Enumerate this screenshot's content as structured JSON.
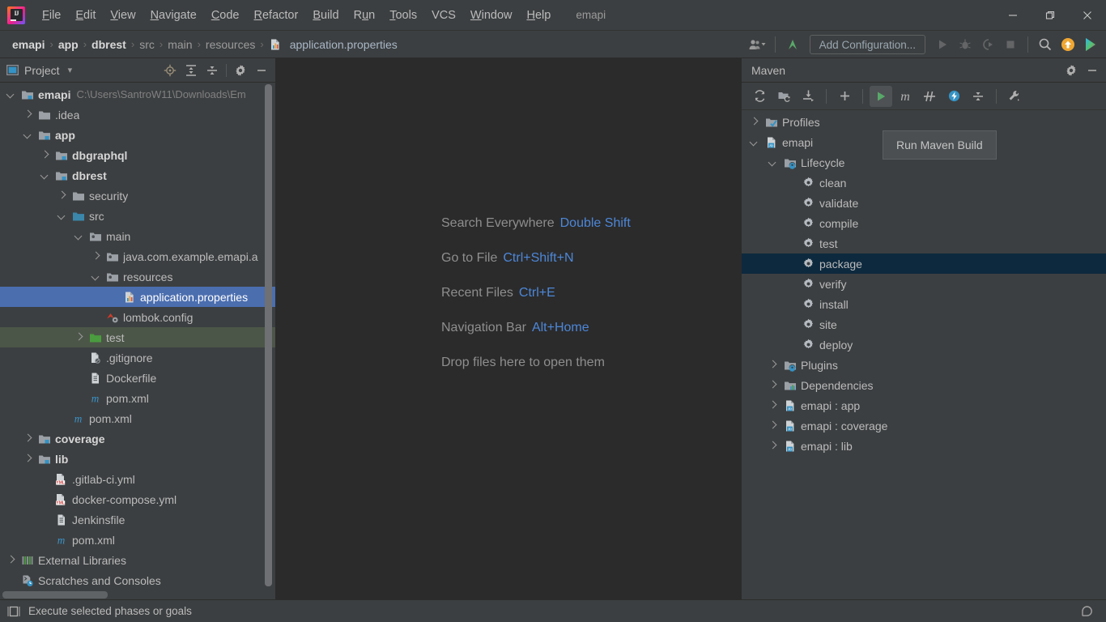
{
  "window": {
    "title": "emapi",
    "logo_text": "IJ",
    "controls": [
      {
        "name": "minimize",
        "glyph": "—"
      },
      {
        "name": "maximize",
        "glyph": "❐"
      },
      {
        "name": "close",
        "glyph": "✕"
      }
    ]
  },
  "menubar": {
    "items": [
      {
        "label": "File",
        "mnemonic": "F"
      },
      {
        "label": "Edit",
        "mnemonic": "E"
      },
      {
        "label": "View",
        "mnemonic": "V"
      },
      {
        "label": "Navigate",
        "mnemonic": "N"
      },
      {
        "label": "Code",
        "mnemonic": "C"
      },
      {
        "label": "Refactor",
        "mnemonic": "R"
      },
      {
        "label": "Build",
        "mnemonic": "B"
      },
      {
        "label": "Run",
        "mnemonic": "u"
      },
      {
        "label": "Tools",
        "mnemonic": "T"
      },
      {
        "label": "VCS",
        "mnemonic": ""
      },
      {
        "label": "Window",
        "mnemonic": "W"
      },
      {
        "label": "Help",
        "mnemonic": "H"
      }
    ]
  },
  "navbar": {
    "breadcrumbs": [
      {
        "label": "emapi",
        "style": "bold"
      },
      {
        "label": "app",
        "style": "bold"
      },
      {
        "label": "dbrest",
        "style": "bold"
      },
      {
        "label": "src",
        "style": "dim"
      },
      {
        "label": "main",
        "style": "dim"
      },
      {
        "label": "resources",
        "style": "dim"
      },
      {
        "label": "application.properties",
        "style": "file",
        "icon": "properties-file-icon"
      }
    ],
    "separator": "›",
    "run_configuration": "Add Configuration...",
    "buttons": [
      {
        "name": "user-settings-icon",
        "label": ""
      },
      {
        "name": "update-project-icon",
        "label": ""
      },
      {
        "name": "run-icon",
        "label": ""
      },
      {
        "name": "debug-icon",
        "label": ""
      },
      {
        "name": "run-with-coverage-icon",
        "label": ""
      },
      {
        "name": "stop-icon",
        "label": ""
      },
      {
        "name": "search-icon",
        "label": ""
      },
      {
        "name": "notification-icon",
        "label": ""
      },
      {
        "name": "ide-helper-icon",
        "label": ""
      }
    ]
  },
  "project_panel": {
    "title": "Project",
    "dropdown_glyph": "▾",
    "toolbar_icons": [
      {
        "name": "locate-file-icon"
      },
      {
        "name": "expand-all-icon"
      },
      {
        "name": "collapse-all-icon"
      },
      {
        "name": "gear-icon"
      },
      {
        "name": "hide-icon"
      }
    ],
    "tree": [
      {
        "indent": 0,
        "arrow": "open",
        "icon": "module-folder-icon",
        "label": "emapi",
        "bold": true,
        "path": "C:\\Users\\SantroW11\\Downloads\\Em"
      },
      {
        "indent": 1,
        "arrow": "closed",
        "icon": "folder-icon",
        "label": ".idea"
      },
      {
        "indent": 1,
        "arrow": "open",
        "icon": "module-folder-icon",
        "label": "app",
        "bold": true
      },
      {
        "indent": 2,
        "arrow": "closed",
        "icon": "module-folder-icon",
        "label": "dbgraphql",
        "bold": true
      },
      {
        "indent": 2,
        "arrow": "open",
        "icon": "module-folder-icon",
        "label": "dbrest",
        "bold": true
      },
      {
        "indent": 3,
        "arrow": "closed",
        "icon": "folder-icon",
        "label": "security"
      },
      {
        "indent": 3,
        "arrow": "open",
        "icon": "source-folder-icon",
        "label": "src"
      },
      {
        "indent": 4,
        "arrow": "open",
        "icon": "package-folder-icon",
        "label": "main"
      },
      {
        "indent": 5,
        "arrow": "closed",
        "icon": "package-folder-icon",
        "label": "java.com.example.emapi.a"
      },
      {
        "indent": 5,
        "arrow": "open",
        "icon": "package-folder-icon",
        "label": "resources"
      },
      {
        "indent": 6,
        "arrow": "none",
        "icon": "properties-file-icon",
        "label": "application.properties",
        "selected": true
      },
      {
        "indent": 5,
        "arrow": "none",
        "icon": "lombok-file-icon",
        "label": "lombok.config"
      },
      {
        "indent": 4,
        "arrow": "closed",
        "icon": "test-folder-icon",
        "label": "test",
        "testsrc": true
      },
      {
        "indent": 4,
        "arrow": "none",
        "icon": "gitignore-file-icon",
        "label": ".gitignore"
      },
      {
        "indent": 4,
        "arrow": "none",
        "icon": "docker-file-icon",
        "label": "Dockerfile"
      },
      {
        "indent": 4,
        "arrow": "none",
        "icon": "maven-pom-icon",
        "label": "pom.xml"
      },
      {
        "indent": 3,
        "arrow": "none",
        "icon": "maven-pom-icon",
        "label": "pom.xml"
      },
      {
        "indent": 1,
        "arrow": "closed",
        "icon": "module-folder-icon",
        "label": "coverage",
        "bold": true
      },
      {
        "indent": 1,
        "arrow": "closed",
        "icon": "module-folder-icon",
        "label": "lib",
        "bold": true
      },
      {
        "indent": 2,
        "arrow": "none",
        "icon": "yml-file-icon",
        "label": ".gitlab-ci.yml"
      },
      {
        "indent": 2,
        "arrow": "none",
        "icon": "yml-file-icon",
        "label": "docker-compose.yml"
      },
      {
        "indent": 2,
        "arrow": "none",
        "icon": "docker-file-icon",
        "label": "Jenkinsfile"
      },
      {
        "indent": 2,
        "arrow": "none",
        "icon": "maven-pom-icon",
        "label": "pom.xml"
      },
      {
        "indent": 0,
        "arrow": "closed",
        "icon": "external-libraries-icon",
        "label": "External Libraries"
      },
      {
        "indent": 0,
        "arrow": "none",
        "icon": "scratches-icon",
        "label": "Scratches and Consoles"
      }
    ]
  },
  "editor": {
    "hints": [
      {
        "label": "Search Everywhere",
        "key": "Double Shift"
      },
      {
        "label": "Go to File",
        "key": "Ctrl+Shift+N"
      },
      {
        "label": "Recent Files",
        "key": "Ctrl+E"
      },
      {
        "label": "Navigation Bar",
        "key": "Alt+Home"
      },
      {
        "label": "Drop files here to open them",
        "key": ""
      }
    ]
  },
  "maven_panel": {
    "title": "Maven",
    "header_icons": [
      {
        "name": "gear-icon"
      },
      {
        "name": "hide-icon"
      }
    ],
    "toolbar_icons": [
      {
        "name": "reload-all-projects-icon"
      },
      {
        "name": "add-maven-project-icon"
      },
      {
        "name": "download-sources-icon"
      },
      {
        "name": "add-icon"
      },
      {
        "name": "run-maven-build-icon",
        "active": true
      },
      {
        "name": "execute-maven-goal-icon"
      },
      {
        "name": "toggle-skip-tests-icon"
      },
      {
        "name": "toggle-offline-mode-icon"
      },
      {
        "name": "collapse-all-icon"
      },
      {
        "name": "maven-settings-icon"
      }
    ],
    "tooltip": "Run Maven Build",
    "tree": [
      {
        "indent": 0,
        "arrow": "closed",
        "icon": "profiles-icon",
        "label": "Profiles"
      },
      {
        "indent": 0,
        "arrow": "open",
        "icon": "maven-project-icon",
        "label": "emapi"
      },
      {
        "indent": 1,
        "arrow": "open",
        "icon": "lifecycle-icon",
        "label": "Lifecycle"
      },
      {
        "indent": 2,
        "arrow": "none",
        "icon": "goal-icon",
        "label": "clean"
      },
      {
        "indent": 2,
        "arrow": "none",
        "icon": "goal-icon",
        "label": "validate"
      },
      {
        "indent": 2,
        "arrow": "none",
        "icon": "goal-icon",
        "label": "compile"
      },
      {
        "indent": 2,
        "arrow": "none",
        "icon": "goal-icon",
        "label": "test"
      },
      {
        "indent": 2,
        "arrow": "none",
        "icon": "goal-icon",
        "label": "package",
        "selected": true
      },
      {
        "indent": 2,
        "arrow": "none",
        "icon": "goal-icon",
        "label": "verify"
      },
      {
        "indent": 2,
        "arrow": "none",
        "icon": "goal-icon",
        "label": "install"
      },
      {
        "indent": 2,
        "arrow": "none",
        "icon": "goal-icon",
        "label": "site"
      },
      {
        "indent": 2,
        "arrow": "none",
        "icon": "goal-icon",
        "label": "deploy"
      },
      {
        "indent": 1,
        "arrow": "closed",
        "icon": "plugins-icon",
        "label": "Plugins"
      },
      {
        "indent": 1,
        "arrow": "closed",
        "icon": "dependencies-icon",
        "label": "Dependencies"
      },
      {
        "indent": 1,
        "arrow": "closed",
        "icon": "maven-project-icon",
        "label": "emapi : app"
      },
      {
        "indent": 1,
        "arrow": "closed",
        "icon": "maven-project-icon",
        "label": "emapi : coverage"
      },
      {
        "indent": 1,
        "arrow": "closed",
        "icon": "maven-project-icon",
        "label": "emapi : lib"
      }
    ]
  },
  "statusbar": {
    "message": "Execute selected phases or goals",
    "left_icon": "toggle-toolwindows-icon",
    "right_icon": "search-everywhere-icon"
  },
  "colors": {
    "panel_bg": "#3c3f41",
    "editor_bg": "#2b2b2b",
    "selection_blue": "#4b6eaf",
    "maven_selection": "#0d293e",
    "test_source_green": "#4c5648",
    "accent_link": "#4d87d8",
    "text": "#bbbbbb",
    "run_green": "#59a869"
  }
}
